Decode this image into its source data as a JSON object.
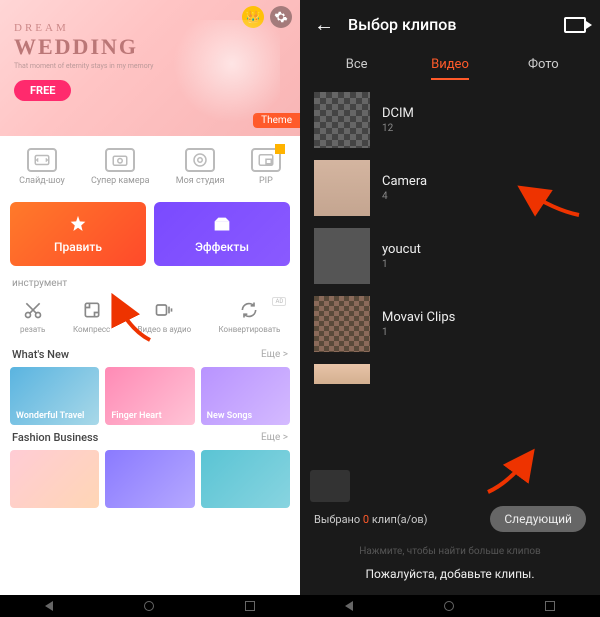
{
  "left": {
    "hero": {
      "pretitle": "DREAM",
      "title": "WEDDING",
      "subtitle": "That moment of eternity stays in my memory",
      "free": "FREE",
      "theme": "Theme"
    },
    "toolbar": [
      {
        "label": "Слайд-шоу"
      },
      {
        "label": "Супер камера"
      },
      {
        "label": "Моя студия"
      },
      {
        "label": "PIP"
      }
    ],
    "big": {
      "edit": "Править",
      "effects": "Эффекты"
    },
    "instrument": "инструмент",
    "tools2": [
      {
        "label": "резать"
      },
      {
        "label": "Компресс"
      },
      {
        "label": "Видео в аудио"
      },
      {
        "label": "Конвертировать",
        "ad": "AD"
      }
    ],
    "whatsnew": {
      "title": "What's New",
      "more": "Еще >"
    },
    "cards": [
      {
        "label": "Wonderful Travel"
      },
      {
        "label": "Finger Heart"
      },
      {
        "label": "New Songs"
      }
    ],
    "fashion": {
      "title": "Fashion Business",
      "more": "Еще >"
    }
  },
  "right": {
    "title": "Выбор клипов",
    "tabs": {
      "all": "Все",
      "video": "Видео",
      "photo": "Фото"
    },
    "folders": [
      {
        "name": "DCIM",
        "count": "12"
      },
      {
        "name": "Camera",
        "count": "4"
      },
      {
        "name": "youcut",
        "count": "1"
      },
      {
        "name": "Movavi Clips",
        "count": "1"
      }
    ],
    "selected_label": "Выбрано",
    "selected_count": "0",
    "selected_unit": "клип(а/ов)",
    "next": "Следующий",
    "hint1": "Нажмите, чтобы найти больше клипов",
    "hint2": "Пожалуйста, добавьте клипы."
  }
}
